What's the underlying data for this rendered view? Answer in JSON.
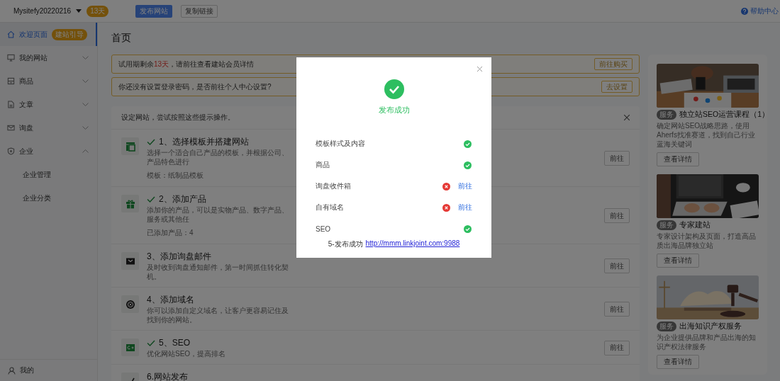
{
  "topbar": {
    "site_name": "Mysitefy20220216",
    "days_badge": "13天",
    "publish_button": "发布网站",
    "copy_link_button": "复制链接",
    "help": "帮助中心"
  },
  "sidebar": {
    "items": [
      {
        "kind": "home",
        "label": "欢迎页面",
        "selected": true,
        "badge": "建站引导"
      },
      {
        "kind": "monitor",
        "label": "我的网站",
        "selected": false,
        "expanded": false
      },
      {
        "kind": "box",
        "label": "商品",
        "selected": false,
        "expanded": false
      },
      {
        "kind": "document",
        "label": "文章",
        "selected": false,
        "expanded": false
      },
      {
        "kind": "mail",
        "label": "询盘",
        "selected": false,
        "expanded": false
      },
      {
        "kind": "shield",
        "label": "企业",
        "selected": false,
        "expanded": true,
        "children": [
          {
            "label": "企业管理",
            "selected": false
          },
          {
            "label": "企业分类",
            "selected": false
          }
        ]
      }
    ],
    "user": "我的"
  },
  "page_title": "首页",
  "notices": [
    {
      "text_before": "试用期剩余",
      "highlight": "13天",
      "text_after": "，请前往查看建站会员详情",
      "button": "前往购买"
    },
    {
      "text_before": "你还没有设置登录密码，是否前往个人中心设置?",
      "button": "去设置"
    }
  ],
  "guide": {
    "heading": "设定网站，尝试按照这些提示操作。",
    "steps": [
      {
        "kind": "template",
        "done": true,
        "title": "1、选择模板并搭建网站",
        "description": "选择一个适合自己产品的模板，并根据公司、产品特色进行",
        "extra": "模板：纸制品模板",
        "button": "前往"
      },
      {
        "kind": "gift",
        "done": true,
        "title": "2、添加产品",
        "description": "添加你的产品，可以是实物产品、数字产品、服务或其他任",
        "extra": "已添加产品：4",
        "button": "前往"
      },
      {
        "kind": "mail",
        "done": false,
        "title": "3、添加询盘邮件",
        "description": "及时收到询盘通知邮件，第一时间抓住转化契机。",
        "button": "前往"
      },
      {
        "kind": "globe",
        "done": false,
        "title": "4、添加域名",
        "description": "你可以添加自定义域名，让客户更容易记住及找到你的网站。",
        "button": "前往"
      },
      {
        "kind": "seo",
        "done": true,
        "title": "5、SEO",
        "description": "优化网站SEO，提高排名",
        "button": "前往"
      },
      {
        "kind": "publish",
        "done": false,
        "title": "6.网站发布"
      }
    ]
  },
  "services": [
    {
      "tag": "服务",
      "title": "独立站SEO运营课程（1）",
      "description": "确定网站SEO战略思路，使用Aherfs找准赛道，找到自己行业蓝海关键词",
      "button": "查看详情"
    },
    {
      "tag": "服务",
      "title": "专家建站",
      "description": "专家设计架构及页面，打造高品质出海品牌独立站",
      "button": "查看详情"
    },
    {
      "tag": "服务",
      "title": "出海知识产权服务",
      "description": "为企业提供品牌和产品出海的知识产权法律服务",
      "button": "查看详情"
    }
  ],
  "dialog": {
    "title": "发布成功",
    "items": [
      {
        "label": "模板样式及内容",
        "ok": true
      },
      {
        "label": "商品",
        "ok": true
      },
      {
        "label": "询盘收件箱",
        "ok": false,
        "link": "前往"
      },
      {
        "label": "自有域名",
        "ok": false,
        "link": "前往"
      },
      {
        "label": "SEO",
        "ok": true
      }
    ],
    "footer_text": "5-发布成功",
    "url": "http://mmm.linkjoint.com:9988"
  }
}
